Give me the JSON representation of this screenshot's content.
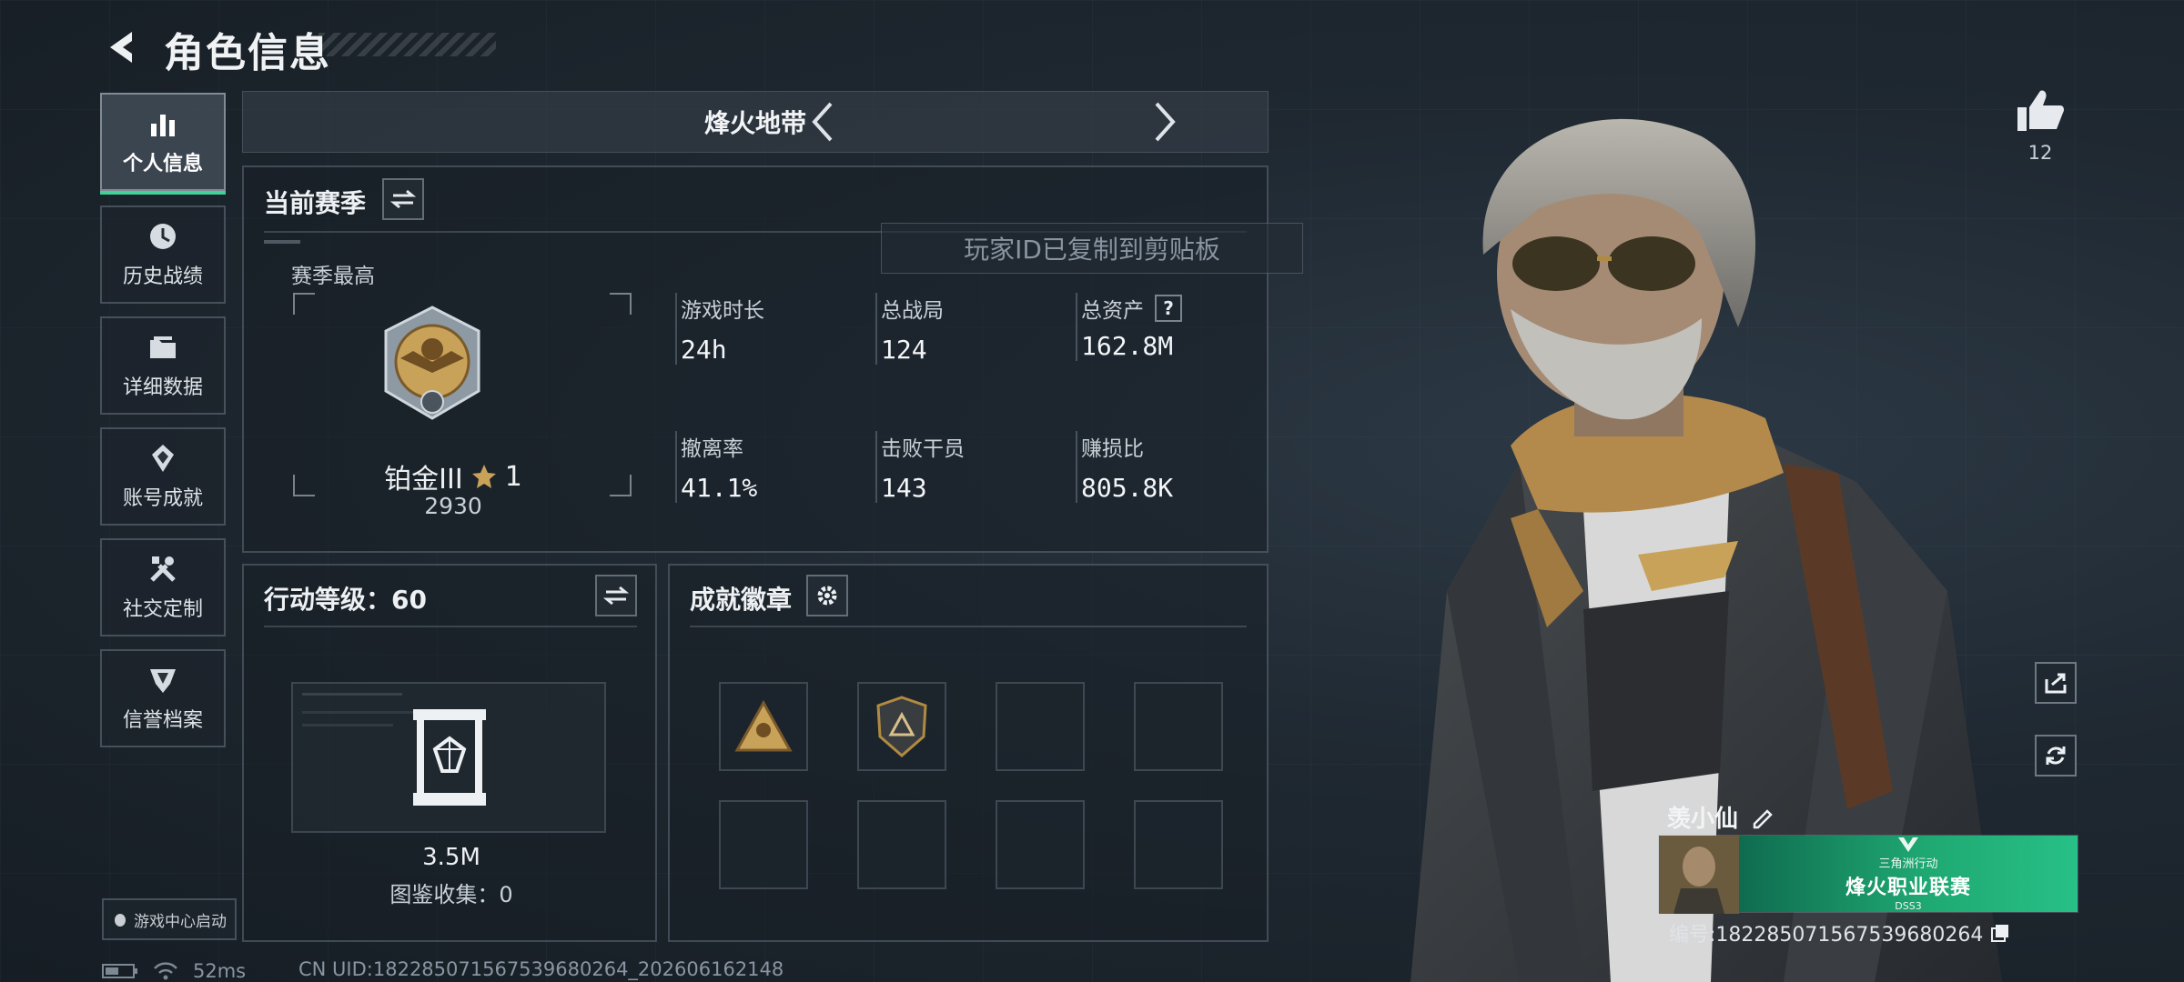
{
  "header": {
    "title": "角色信息"
  },
  "sidebar": {
    "items": [
      {
        "label": "个人信息",
        "icon": "bar-chart-icon",
        "active": true
      },
      {
        "label": "历史战绩",
        "icon": "history-clock-icon"
      },
      {
        "label": "详细数据",
        "icon": "folder-icon"
      },
      {
        "label": "账号成就",
        "icon": "achievement-icon"
      },
      {
        "label": "社交定制",
        "icon": "tools-icon"
      },
      {
        "label": "信誉档案",
        "icon": "credit-shield-icon"
      }
    ],
    "launch_label": "游戏中心启动"
  },
  "mode": {
    "title": "烽火地带"
  },
  "season": {
    "title": "当前赛季",
    "best_label": "赛季最高",
    "rank_name": "铂金III",
    "rank_stars": "1",
    "rank_score": "2930",
    "stats": [
      {
        "label": "游戏时长",
        "value": "24h"
      },
      {
        "label": "总战局",
        "value": "124"
      },
      {
        "label": "总资产",
        "value": "162.8M"
      },
      {
        "label": "撤离率",
        "value": "41.1%"
      },
      {
        "label": "击败干员",
        "value": "143"
      },
      {
        "label": "赚损比",
        "value": "805.8K"
      }
    ],
    "help_mark": "?"
  },
  "toast": {
    "text": "玩家ID已复制到剪贴板"
  },
  "action_level": {
    "title": "行动等级：60",
    "value": "3.5M",
    "collection": "图鉴收集：0"
  },
  "achievements": {
    "title": "成就徽章"
  },
  "likes": {
    "count": "12"
  },
  "player": {
    "name": "羡小仙",
    "id_text": "编号:1822850715675396802​64",
    "banner_line1": "三角洲行动",
    "banner_line2": "烽火职业联赛",
    "banner_line3": "DSS3"
  },
  "status_bar": {
    "ping": "52ms",
    "uid": "CN UID:182285071567539680264_202606162148"
  },
  "colors": {
    "accent": "#3fd39a",
    "background": "#1a222a",
    "gold": "#c9a25a"
  }
}
